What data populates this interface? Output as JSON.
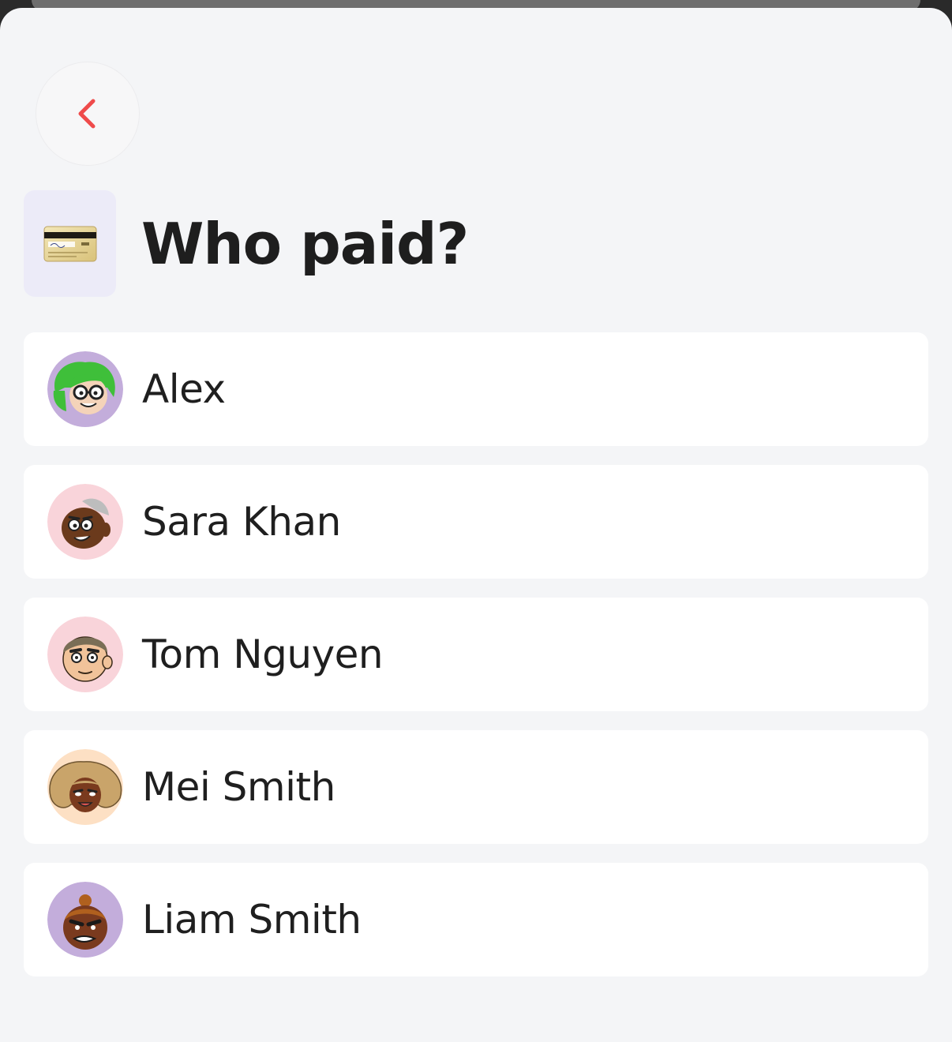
{
  "screen": {
    "title": "Who paid?",
    "header_icon": "credit-card-icon",
    "back_icon": "chevron-left-icon"
  },
  "colors": {
    "accent": "#ef4b4b",
    "sheet_background": "#f4f5f7",
    "row_background": "#ffffff",
    "icon_tile_background": "#ecebf8",
    "text": "#1e1e1e"
  },
  "people": [
    {
      "name": "Alex",
      "avatar": "avatar-cartoon-green-hair-glasses",
      "avatar_bg": "#c3addb"
    },
    {
      "name": "Sara Khan",
      "avatar": "avatar-cartoon-grey-hair",
      "avatar_bg": "#f9d4da"
    },
    {
      "name": "Tom Nguyen",
      "avatar": "avatar-cartoon-short-hair",
      "avatar_bg": "#f9d4da"
    },
    {
      "name": "Mei Smith",
      "avatar": "avatar-cartoon-curly-blonde-hair",
      "avatar_bg": "#fde0c4"
    },
    {
      "name": "Liam Smith",
      "avatar": "avatar-cartoon-top-knot",
      "avatar_bg": "#c3addb"
    }
  ]
}
